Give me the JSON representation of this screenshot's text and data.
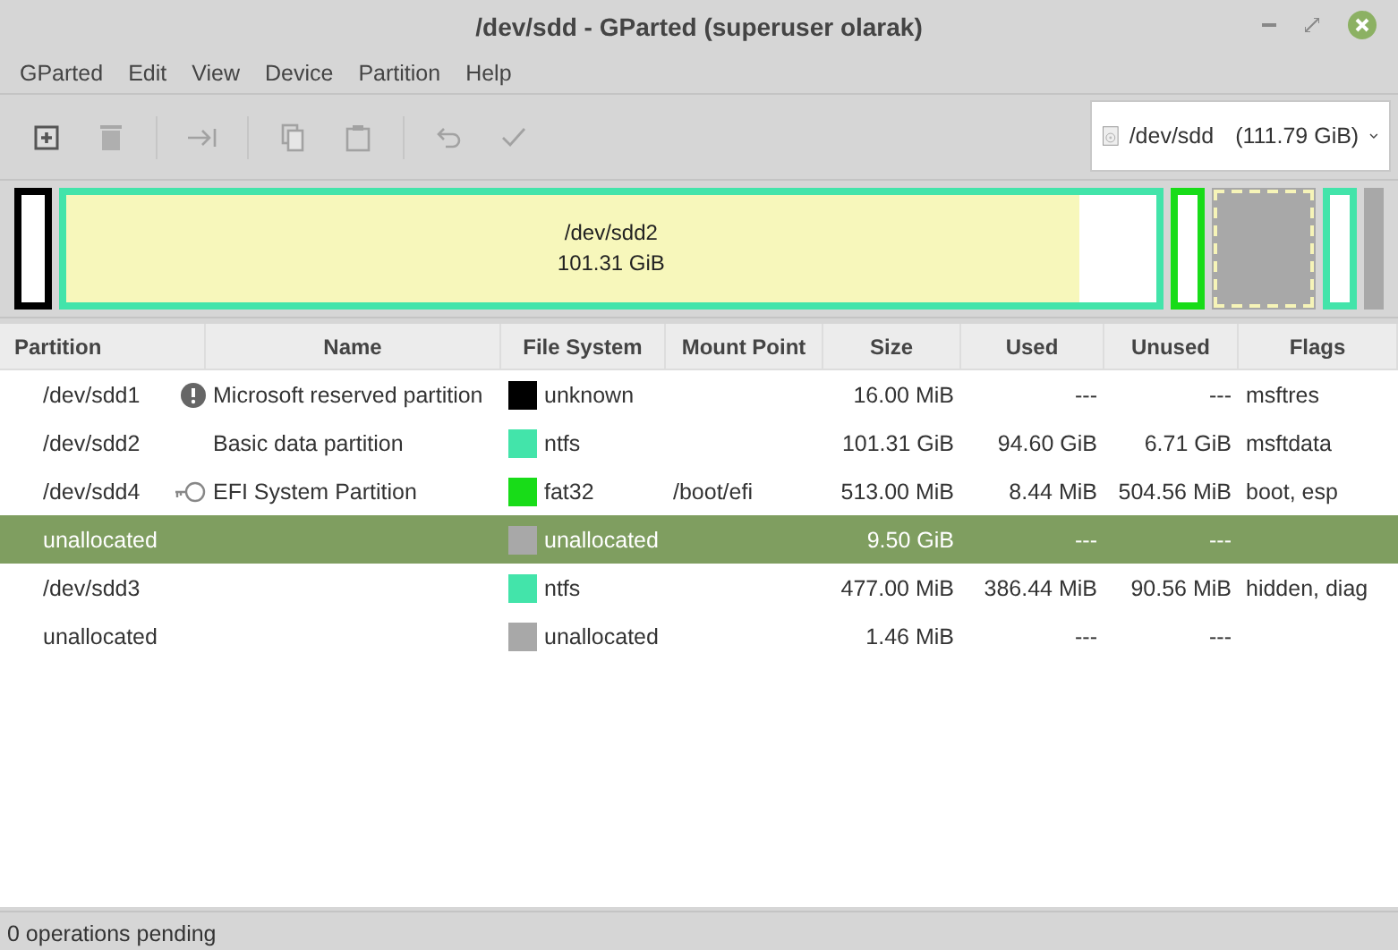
{
  "window": {
    "title": "/dev/sdd - GParted (superuser olarak)"
  },
  "menu": [
    "GParted",
    "Edit",
    "View",
    "Device",
    "Partition",
    "Help"
  ],
  "toolbar": [
    {
      "kind": "new",
      "disabled": false
    },
    {
      "kind": "delete",
      "disabled": true
    },
    {
      "kind": "sep"
    },
    {
      "kind": "resize",
      "disabled": true
    },
    {
      "kind": "sep"
    },
    {
      "kind": "copy",
      "disabled": true
    },
    {
      "kind": "paste",
      "disabled": true
    },
    {
      "kind": "sep"
    },
    {
      "kind": "undo",
      "disabled": true
    },
    {
      "kind": "apply",
      "disabled": true
    }
  ],
  "device": {
    "name": "/dev/sdd",
    "size": "(111.79 GiB)"
  },
  "disk_map": [
    {
      "kind": "partition",
      "color": "#000000",
      "selected": false
    },
    {
      "kind": "partition",
      "color": "#43e4aa",
      "selected": false,
      "level": 0.93,
      "name": "/dev/sdd2",
      "size": "101.31 GiB"
    },
    {
      "kind": "partition",
      "color": "#18dc18",
      "selected": false
    },
    {
      "kind": "unallocated",
      "color": "#a8a8a8",
      "selected": true
    },
    {
      "kind": "partition",
      "color": "#43e4aa",
      "selected": false
    },
    {
      "kind": "unallocated",
      "color": "#a8a8a8",
      "selected": false
    }
  ],
  "table": {
    "columns": [
      "Partition",
      "Name",
      "File System",
      "Mount Point",
      "Size",
      "Used",
      "Unused",
      "Flags"
    ],
    "rows": [
      {
        "partition": "/dev/sdd1",
        "kind": "warning",
        "name": "Microsoft reserved partition",
        "color": "#000000",
        "fs": "unknown",
        "size": "16.00 MiB",
        "used": "---",
        "unused": "---",
        "flags": "msftres",
        "selected": false
      },
      {
        "partition": "/dev/sdd2",
        "name": "Basic data partition",
        "color": "#43e4aa",
        "fs": "ntfs",
        "size": "101.31 GiB",
        "used": "94.60 GiB",
        "unused": "6.71 GiB",
        "flags": "msftdata",
        "selected": false
      },
      {
        "partition": "/dev/sdd4",
        "kind": "key",
        "name": "EFI System Partition",
        "color": "#18dc18",
        "fs": "fat32",
        "mount": "/boot/efi",
        "size": "513.00 MiB",
        "used": "8.44 MiB",
        "unused": "504.56 MiB",
        "flags": "boot, esp",
        "selected": false
      },
      {
        "partition": "unallocated",
        "color": "#a8a8a8",
        "fs": "unallocated",
        "size": "9.50 GiB",
        "used": "---",
        "unused": "---",
        "selected": true
      },
      {
        "partition": "/dev/sdd3",
        "color": "#43e4aa",
        "fs": "ntfs",
        "size": "477.00 MiB",
        "used": "386.44 MiB",
        "unused": "90.56 MiB",
        "flags": "hidden, diag",
        "selected": false
      },
      {
        "partition": "unallocated",
        "color": "#a8a8a8",
        "fs": "unallocated",
        "size": "1.46 MiB",
        "used": "---",
        "unused": "---",
        "selected": false
      }
    ]
  },
  "status_bar": "0 operations pending"
}
